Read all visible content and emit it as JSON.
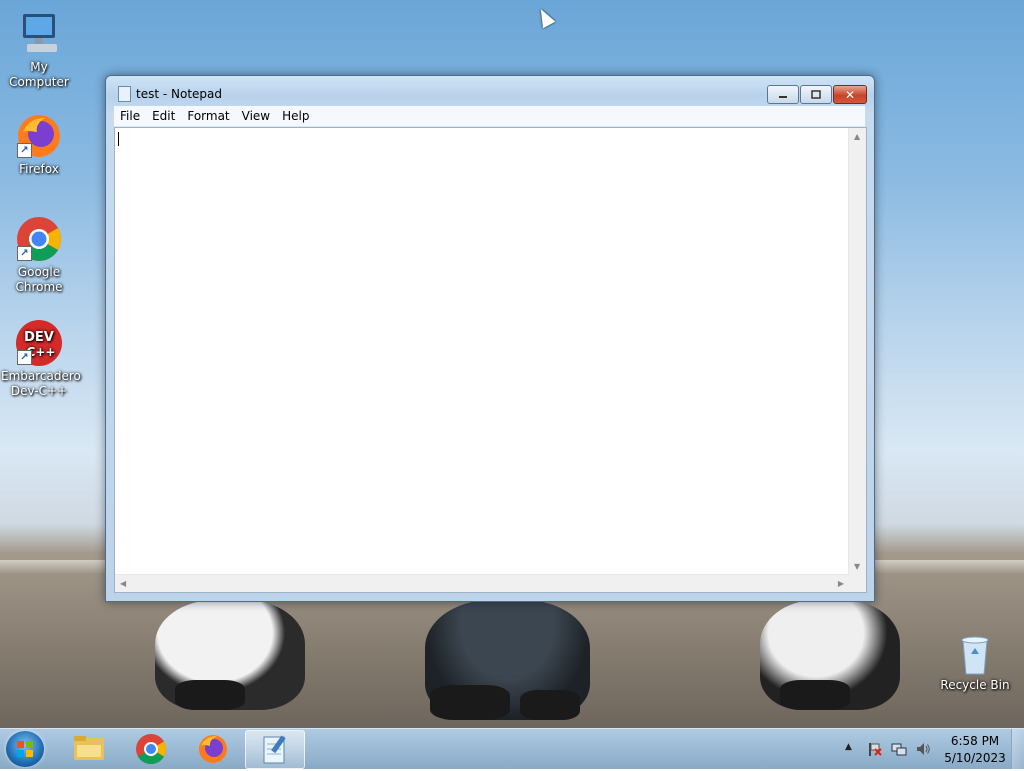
{
  "desktop": {
    "icons": [
      {
        "label": "My Computer"
      },
      {
        "label": "Firefox"
      },
      {
        "label": "Google Chrome"
      },
      {
        "label": "Embarcadero Dev-C++"
      },
      {
        "label": "Recycle Bin"
      }
    ],
    "devcpp_logo_text": "DEV C++"
  },
  "notepad": {
    "title": "test - Notepad",
    "menu": [
      "File",
      "Edit",
      "Format",
      "View",
      "Help"
    ],
    "content": "",
    "buttons": {
      "close_glyph": "✕"
    }
  },
  "taskbar": {
    "pinned": [
      "windows-explorer",
      "google-chrome",
      "firefox",
      "notepad"
    ],
    "active": "notepad",
    "tray_expand_glyph": "▲",
    "time": "6:58 PM",
    "date": "5/10/2023"
  }
}
